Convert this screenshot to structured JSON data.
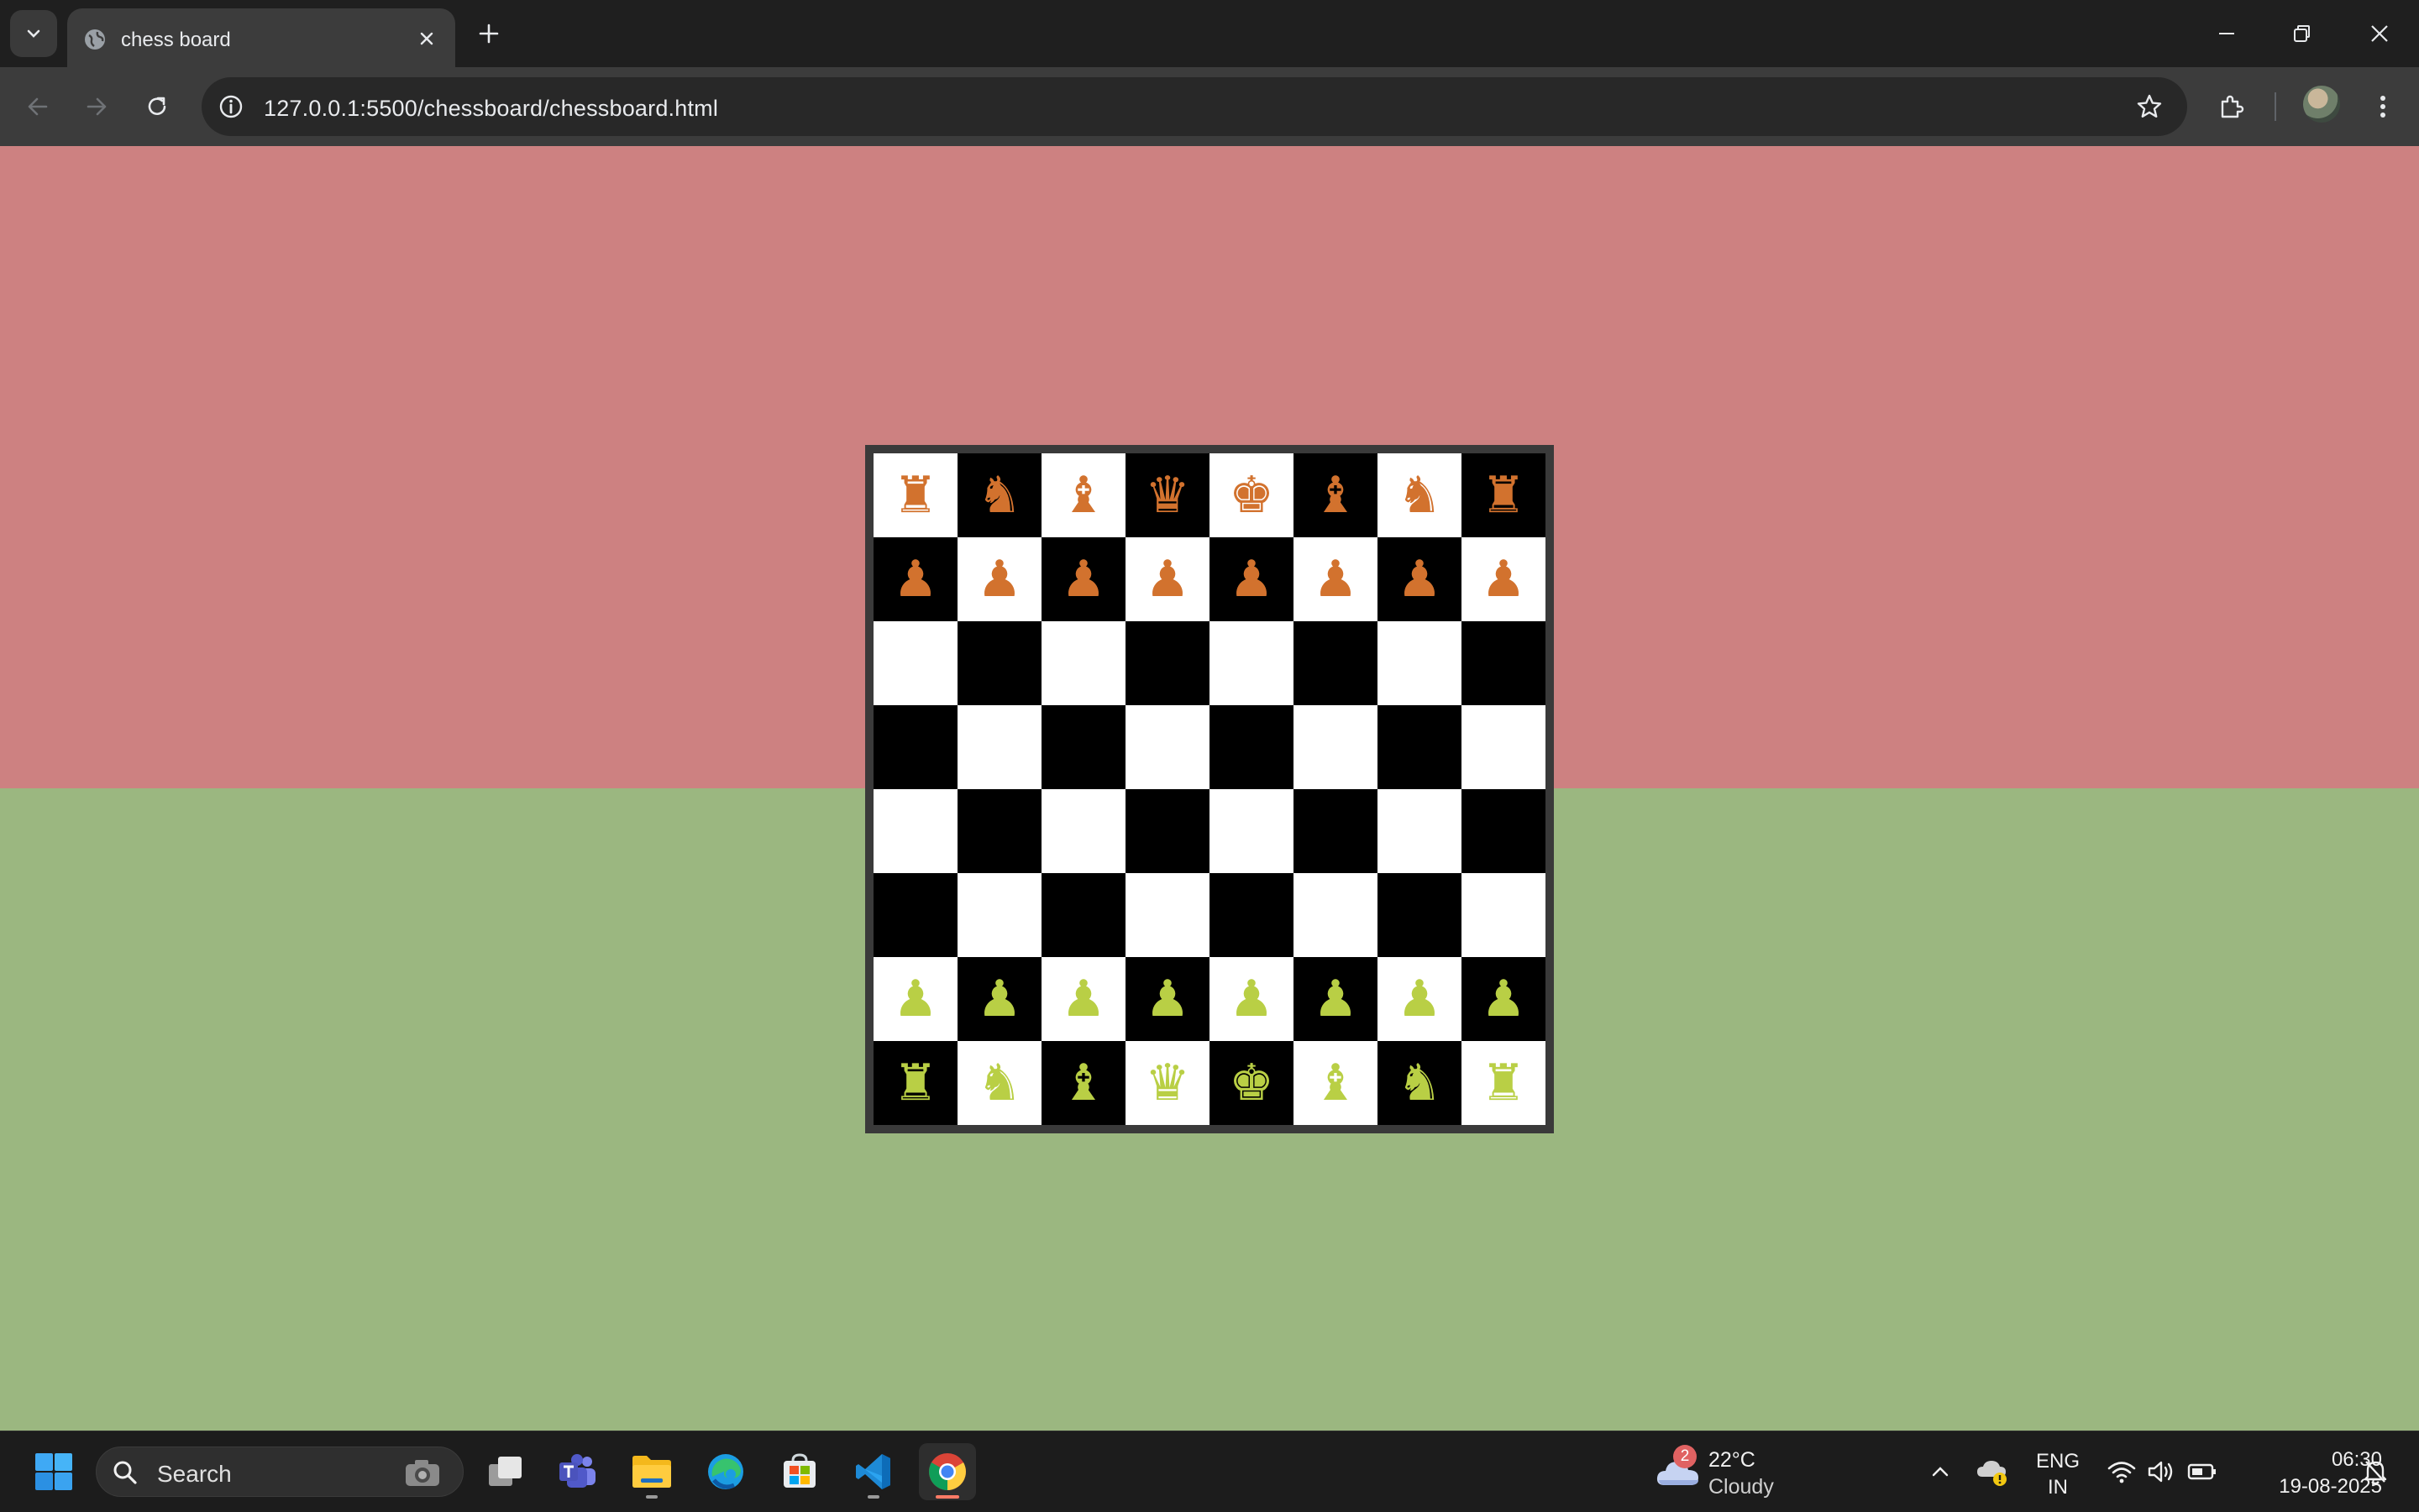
{
  "browser": {
    "tab_title": "chess board",
    "url": "127.0.0.1:5500/chessboard/chessboard.html",
    "icons": [
      "tab-search-icon",
      "globe-icon",
      "close-icon",
      "plus-icon",
      "minimize-icon",
      "restore-icon",
      "window-close-icon",
      "back-icon",
      "forward-icon",
      "reload-icon",
      "info-icon",
      "star-icon",
      "extensions-icon",
      "profile-avatar",
      "menu-icon"
    ]
  },
  "page": {
    "colors": {
      "top_half": "#cd8181",
      "bottom_half": "#9bb780",
      "light_square": "#ffffff",
      "dark_square": "#000000",
      "black_pieces": "#d2722e",
      "white_pieces": "#b9cf45",
      "board_border": "#3a3a3a"
    },
    "board": {
      "ranks": [
        [
          "♜",
          "♞",
          "♝",
          "♛",
          "♚",
          "♝",
          "♞",
          "♜"
        ],
        [
          "♟",
          "♟",
          "♟",
          "♟",
          "♟",
          "♟",
          "♟",
          "♟"
        ],
        [
          "",
          "",
          "",
          "",
          "",
          "",
          "",
          ""
        ],
        [
          "",
          "",
          "",
          "",
          "",
          "",
          "",
          ""
        ],
        [
          "",
          "",
          "",
          "",
          "",
          "",
          "",
          ""
        ],
        [
          "",
          "",
          "",
          "",
          "",
          "",
          "",
          ""
        ],
        [
          "♟",
          "♟",
          "♟",
          "♟",
          "♟",
          "♟",
          "♟",
          "♟"
        ],
        [
          "♜",
          "♞",
          "♝",
          "♛",
          "♚",
          "♝",
          "♞",
          "♜"
        ]
      ]
    }
  },
  "taskbar": {
    "search_label": "Search",
    "weather": {
      "badge": "2",
      "temp": "22°C",
      "condition": "Cloudy"
    },
    "language": {
      "line1": "ENG",
      "line2": "IN"
    },
    "clock": {
      "time": "06:30",
      "date": "19-08-2025"
    },
    "apps": [
      "start-icon",
      "task-view-icon",
      "teams-icon",
      "file-explorer-icon",
      "edge-icon",
      "store-icon",
      "vscode-icon",
      "chrome-icon"
    ]
  }
}
